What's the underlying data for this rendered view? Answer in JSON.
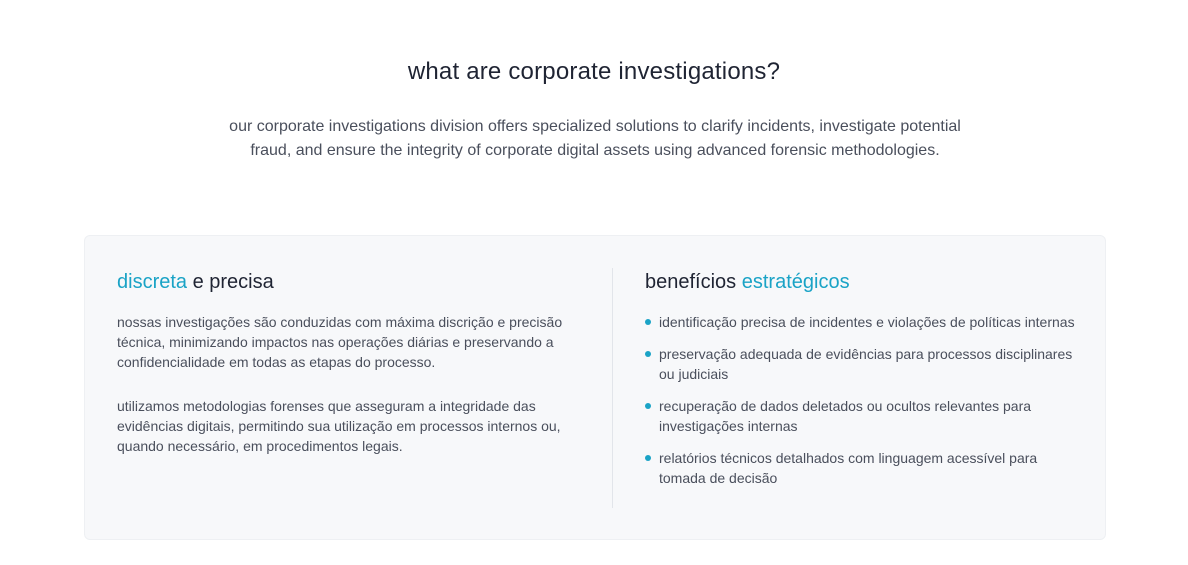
{
  "hero": {
    "title": "what are corporate investigations?",
    "description": "our corporate investigations division offers specialized solutions to clarify incidents, investigate potential fraud, and ensure the integrity of corporate digital assets using advanced forensic methodologies."
  },
  "left_column": {
    "title_accent": "discreta",
    "title_rest": " e precisa",
    "paragraphs": [
      "nossas investigações são conduzidas com máxima discrição e precisão técnica, minimizando impactos nas operações diárias e preservando a confidencialidade em todas as etapas do processo.",
      "utilizamos metodologias forenses que asseguram a integridade das evidências digitais, permitindo sua utilização em processos internos ou, quando necessário, em procedimentos legais."
    ]
  },
  "right_column": {
    "title_rest": "benefícios ",
    "title_accent": "estratégicos",
    "items": [
      "identificação precisa de incidentes e violações de políticas internas",
      "preservação adequada de evidências para processos disciplinares ou judiciais",
      "recuperação de dados deletados ou ocultos relevantes para investigações internas",
      "relatórios técnicos detalhados com linguagem acessível para tomada de decisão"
    ]
  },
  "colors": {
    "accent": "#1aa3c6",
    "heading": "#1f2433",
    "body_text": "#4a4f5c",
    "card_background": "#f7f8fa"
  }
}
